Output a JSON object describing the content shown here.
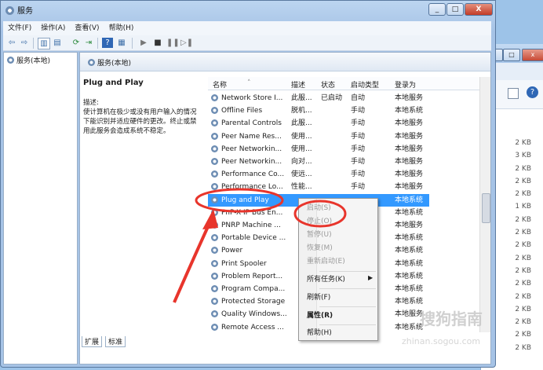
{
  "window": {
    "title": "服务",
    "min_label": "_",
    "max_label": "□",
    "close_label": "X"
  },
  "menubar": [
    "文件(F)",
    "操作(A)",
    "查看(V)",
    "帮助(H)"
  ],
  "tree": {
    "root": "服务(本地)"
  },
  "pane": {
    "header": "服务(本地)",
    "selected_name": "Plug and Play",
    "desc_label": "描述:",
    "desc_text": "使计算机在极少或没有用户输入的情况下能识别并适应硬件的更改。终止或禁用此服务会造成系统不稳定。"
  },
  "columns": [
    "名称",
    "描述",
    "状态",
    "启动类型",
    "登录为"
  ],
  "services": [
    {
      "name": "Network Store I...",
      "desc": "此服...",
      "status": "已启动",
      "startup": "自动",
      "logon": "本地服务"
    },
    {
      "name": "Offline Files",
      "desc": "脱机...",
      "status": "",
      "startup": "手动",
      "logon": "本地系统"
    },
    {
      "name": "Parental Controls",
      "desc": "此服...",
      "status": "",
      "startup": "手动",
      "logon": "本地服务"
    },
    {
      "name": "Peer Name Res...",
      "desc": "使用...",
      "status": "",
      "startup": "手动",
      "logon": "本地服务"
    },
    {
      "name": "Peer Networkin...",
      "desc": "使用...",
      "status": "",
      "startup": "手动",
      "logon": "本地服务"
    },
    {
      "name": "Peer Networkin...",
      "desc": "向对...",
      "status": "",
      "startup": "手动",
      "logon": "本地服务"
    },
    {
      "name": "Performance Co...",
      "desc": "使远...",
      "status": "",
      "startup": "手动",
      "logon": "本地服务"
    },
    {
      "name": "Performance Lo...",
      "desc": "性能...",
      "status": "",
      "startup": "手动",
      "logon": "本地服务"
    },
    {
      "name": "Plug and Play",
      "desc": "",
      "status": "",
      "startup": "",
      "logon": "本地系统"
    },
    {
      "name": "PnP-X IP Bus En...",
      "desc": "",
      "status": "",
      "startup": "",
      "logon": "本地系统"
    },
    {
      "name": "PNRP Machine ...",
      "desc": "",
      "status": "",
      "startup": "",
      "logon": "本地服务"
    },
    {
      "name": "Portable Device ...",
      "desc": "",
      "status": "",
      "startup": "",
      "logon": "本地系统"
    },
    {
      "name": "Power",
      "desc": "",
      "status": "",
      "startup": "",
      "logon": "本地系统"
    },
    {
      "name": "Print Spooler",
      "desc": "",
      "status": "",
      "startup": "",
      "logon": "本地系统"
    },
    {
      "name": "Problem Report...",
      "desc": "",
      "status": "",
      "startup": "",
      "logon": "本地系统"
    },
    {
      "name": "Program Compa...",
      "desc": "",
      "status": "",
      "startup": "",
      "logon": "本地系统"
    },
    {
      "name": "Protected Storage",
      "desc": "",
      "status": "",
      "startup": "",
      "logon": "本地系统"
    },
    {
      "name": "Quality Windows...",
      "desc": "",
      "status": "",
      "startup": "",
      "logon": "本地服务"
    },
    {
      "name": "Remote Access ...",
      "desc": "",
      "status": "",
      "startup": "",
      "logon": "本地系统"
    }
  ],
  "context_menu": {
    "start": "启动(S)",
    "stop": "停止(O)",
    "pause": "暂停(U)",
    "resume": "恢复(M)",
    "restart": "重新启动(E)",
    "all_tasks": "所有任务(K)",
    "refresh": "刷新(F)",
    "properties": "属性(R)",
    "help": "帮助(H)"
  },
  "tabs": [
    "扩展",
    "标准"
  ],
  "background_window": {
    "sizes": [
      "2 KB",
      "3 KB",
      "2 KB",
      "2 KB",
      "2 KB",
      "1 KB",
      "2 KB",
      "2 KB",
      "2 KB",
      "2 KB",
      "2 KB",
      "2 KB",
      "2 KB",
      "2 KB",
      "2 KB",
      "2 KB",
      "2 KB"
    ]
  },
  "watermark": {
    "brand": "搜狗指南",
    "url": "zhinan.sogou.com"
  },
  "colors": {
    "selection": "#3399ff",
    "annotation": "#e8352c"
  }
}
